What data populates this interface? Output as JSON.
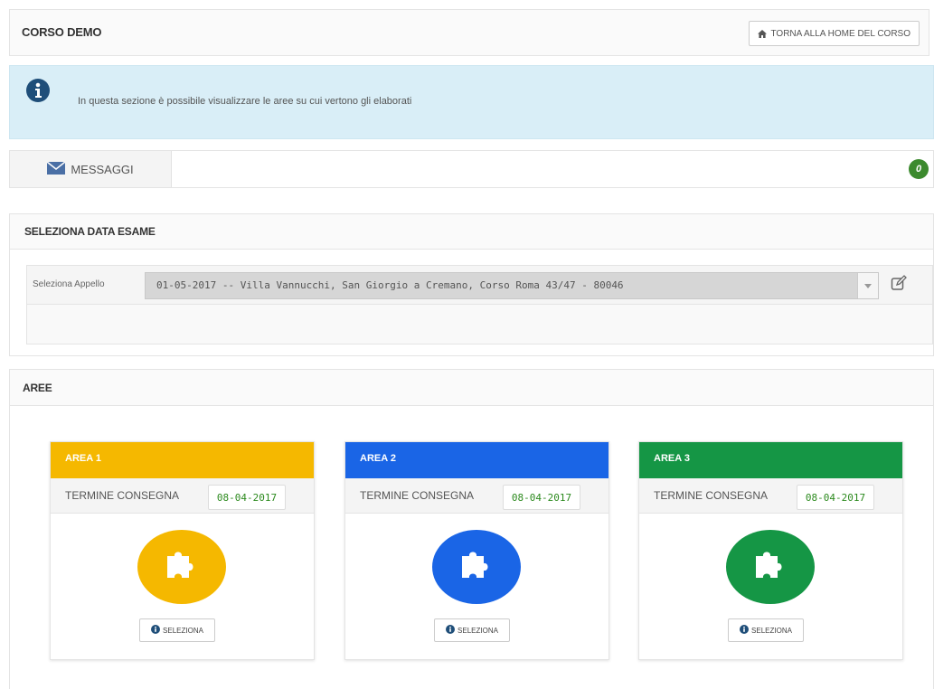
{
  "header": {
    "title": "CORSO DEMO",
    "home_button": "TORNA ALLA HOME DEL CORSO"
  },
  "info": {
    "text": "In questa sezione è possibile visualizzare le aree su cui vertono gli elaborati"
  },
  "messages": {
    "tab_label": "MESSAGGI",
    "badge_count": "0"
  },
  "exam_date": {
    "title": "SELEZIONA DATA ESAME",
    "select_label": "Seleziona Appello",
    "selected_value": "01-05-2017 -- Villa Vannucchi, San Giorgio a Cremano, Corso Roma 43/47 - 80046"
  },
  "areas": {
    "title": "AREE",
    "items": [
      {
        "name": "AREA 1",
        "deadline_label": "TERMINE CONSEGNA",
        "deadline": "08-04-2017",
        "button": "SELEZIONA",
        "color": "#f5b800"
      },
      {
        "name": "AREA 2",
        "deadline_label": "TERMINE CONSEGNA",
        "deadline": "08-04-2017",
        "button": "SELEZIONA",
        "color": "#1a65e6"
      },
      {
        "name": "AREA 3",
        "deadline_label": "TERMINE CONSEGNA",
        "deadline": "08-04-2017",
        "button": "SELEZIONA",
        "color": "#159645"
      }
    ]
  },
  "colors": {
    "info_bg": "#d9eef7",
    "badge": "#3c8a2e",
    "deadline_text": "#2c8a1e"
  }
}
